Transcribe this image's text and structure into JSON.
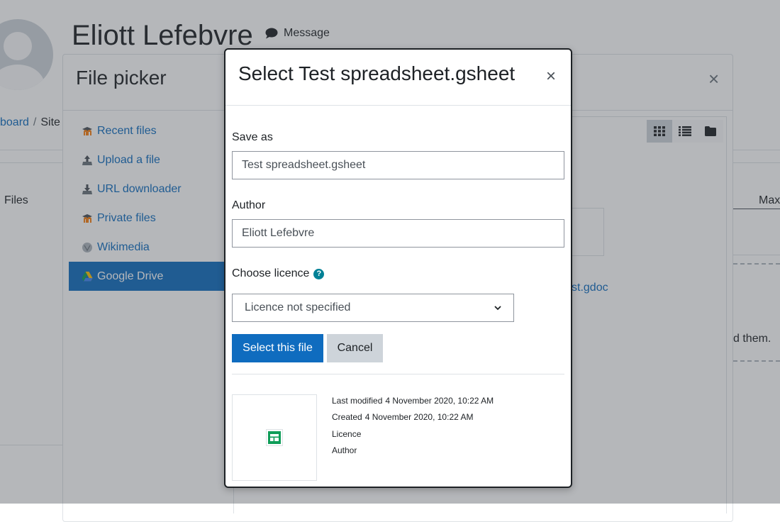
{
  "profile": {
    "name": "Eliott Lefebvre",
    "message_label": "Message"
  },
  "breadcrumb": {
    "first": "board",
    "separator": "/",
    "second": "Site"
  },
  "background": {
    "files_label": "Files",
    "max_label": "Max",
    "drop_text": "d them."
  },
  "file_picker": {
    "title": "File picker",
    "close": "×",
    "repositories": [
      {
        "label": "Recent files",
        "icon": "moodle-icon"
      },
      {
        "label": "Upload a file",
        "icon": "upload-icon"
      },
      {
        "label": "URL downloader",
        "icon": "url-downloader-icon"
      },
      {
        "label": "Private files",
        "icon": "moodle-icon"
      },
      {
        "label": "Wikimedia",
        "icon": "wikimedia-icon"
      },
      {
        "label": "Google Drive",
        "icon": "google-drive-icon",
        "active": true
      }
    ],
    "file_label": "st.gdoc",
    "views": [
      "grid-view-icon",
      "list-view-icon",
      "folder-view-icon"
    ]
  },
  "select_dialog": {
    "title": "Select Test spreadsheet.gsheet",
    "close": "×",
    "save_as_label": "Save as",
    "save_as_value": "Test spreadsheet.gsheet",
    "author_label": "Author",
    "author_value": "Eliott Lefebvre",
    "licence_label": "Choose licence",
    "help_glyph": "?",
    "licence_selected": "Licence not specified",
    "select_button": "Select this file",
    "cancel_button": "Cancel",
    "info": {
      "last_modified_label": "Last modified",
      "last_modified_value": "4 November 2020, 10:22 AM",
      "created_label": "Created",
      "created_value": "4 November 2020, 10:22 AM",
      "licence_label": "Licence",
      "author_label": "Author"
    }
  },
  "colors": {
    "primary": "#0f6cbf",
    "secondary": "#ced4da",
    "help": "#008196",
    "sheet_green": "#0f9d58"
  }
}
